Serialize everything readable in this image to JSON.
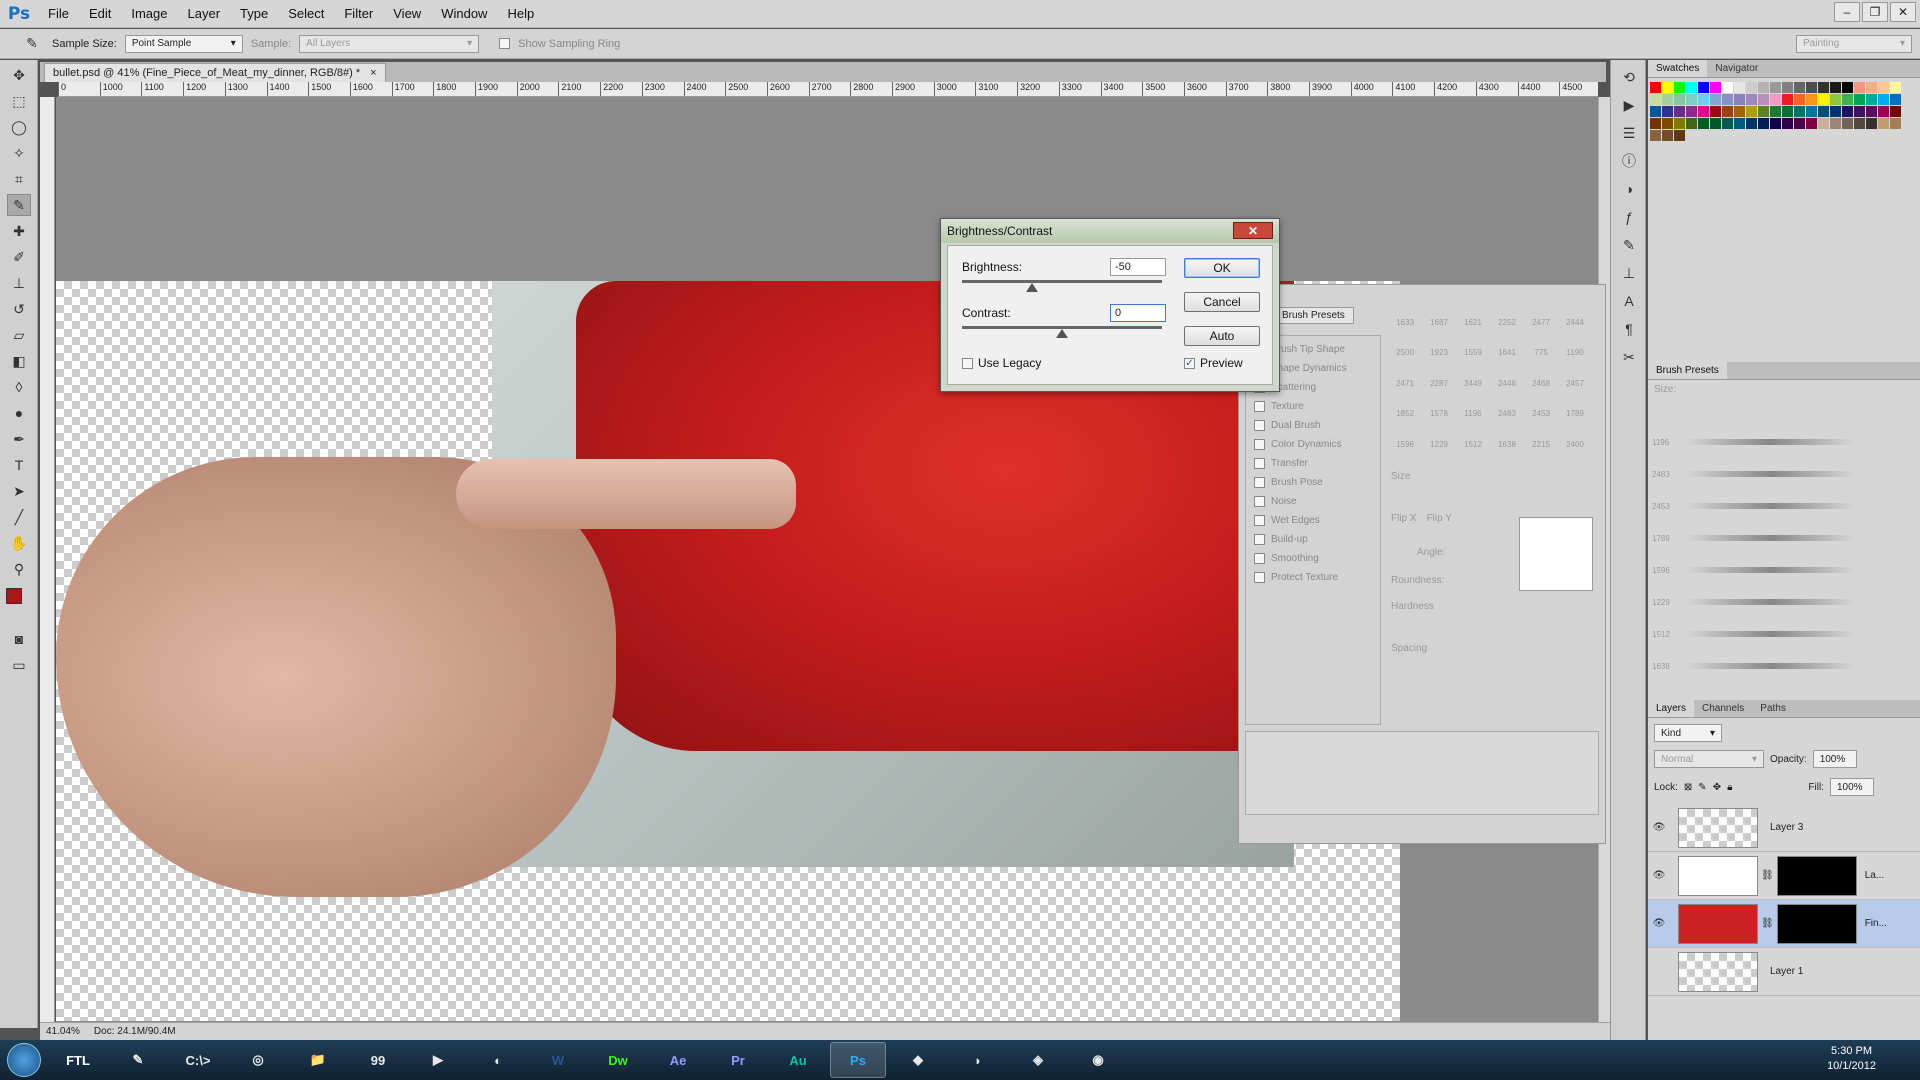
{
  "app": {
    "logo": "Ps"
  },
  "menu": [
    "File",
    "Edit",
    "Image",
    "Layer",
    "Type",
    "Select",
    "Filter",
    "View",
    "Window",
    "Help"
  ],
  "window_controls": {
    "minimize": "–",
    "restore": "❐",
    "close": "✕"
  },
  "options": {
    "sample_size_label": "Sample Size:",
    "sample_size_value": "Point Sample",
    "sample_label": "Sample:",
    "sample_value": "All Layers",
    "sampling_ring_label": "Show Sampling Ring",
    "workspace": "Painting"
  },
  "document": {
    "tab_title": "bullet.psd @ 41% (Fine_Piece_of_Meat_my_dinner, RGB/8#) *",
    "tab_close": "×"
  },
  "ruler_h_ticks": [
    "0",
    "1000",
    "1100",
    "1200",
    "1300",
    "1400",
    "1500",
    "1600",
    "1700",
    "1800",
    "1900",
    "2000",
    "2100",
    "2200",
    "2300",
    "2400",
    "2500",
    "2600",
    "2700",
    "2800",
    "2900",
    "3000",
    "3100",
    "3200",
    "3300",
    "3400",
    "3500",
    "3600",
    "3700",
    "3800",
    "3900",
    "4000",
    "4100",
    "4200",
    "4300",
    "4400",
    "4500"
  ],
  "status": {
    "zoom": "41.04%",
    "doc": "Doc: 24.1M/90.4M"
  },
  "dialog": {
    "title": "Brightness/Contrast",
    "close": "✕",
    "brightness_label": "Brightness:",
    "brightness_value": "-50",
    "contrast_label": "Contrast:",
    "contrast_value": "0",
    "use_legacy_label": "Use Legacy",
    "preview_label": "Preview",
    "preview_checked": true,
    "use_legacy_checked": false,
    "ok": "OK",
    "cancel": "Cancel",
    "auto": "Auto",
    "brightness_fraction": 0.35,
    "contrast_fraction": 0.5
  },
  "brush_panel": {
    "tab": "Brush Presets",
    "items": [
      "Brush Tip Shape",
      "Shape Dynamics",
      "Scattering",
      "Texture",
      "Dual Brush",
      "Color Dynamics",
      "Transfer",
      "Brush Pose",
      "Noise",
      "Wet Edges",
      "Build-up",
      "Smoothing",
      "Protect Texture"
    ],
    "sizes": [
      "1633",
      "1687",
      "1621",
      "2252",
      "2477",
      "2444",
      "2500",
      "1923",
      "1559",
      "1641",
      "775",
      "1190",
      "2471",
      "2287",
      "2449",
      "2446",
      "2468",
      "2457",
      "1852",
      "1578",
      "1196",
      "2483",
      "2453",
      "1789",
      "1596",
      "1229",
      "1512",
      "1638",
      "2215",
      "2400"
    ],
    "size_label": "Size",
    "flip_x": "Flip X",
    "flip_y": "Flip Y",
    "angle": "Angle:",
    "roundness": "Roundness:",
    "hardness": "Hardness",
    "spacing": "Spacing"
  },
  "swatches_tabs": [
    "Swatches",
    "Navigator"
  ],
  "swatch_colors": [
    "#ff0000",
    "#ffff00",
    "#00ff00",
    "#00ffff",
    "#0000ff",
    "#ff00ff",
    "#ffffff",
    "#e6e6e6",
    "#cccccc",
    "#b3b3b3",
    "#999999",
    "#808080",
    "#666666",
    "#4d4d4d",
    "#333333",
    "#1a1a1a",
    "#000000",
    "#f7977a",
    "#f9ad81",
    "#fdc68a",
    "#fff79a",
    "#c4df9b",
    "#a2d39c",
    "#82ca9d",
    "#7bcdc8",
    "#6ecff6",
    "#7ea7d8",
    "#8493ca",
    "#8882be",
    "#a187be",
    "#bc8dbf",
    "#f49ac2",
    "#ed1c24",
    "#f26522",
    "#f7941d",
    "#fff200",
    "#8dc63f",
    "#39b54a",
    "#00a651",
    "#00a99d",
    "#00aeef",
    "#0072bc",
    "#0054a6",
    "#2e3192",
    "#662d91",
    "#92278f",
    "#ec008c",
    "#9e0b0f",
    "#a0410d",
    "#a36209",
    "#aba000",
    "#598527",
    "#1a7b30",
    "#007236",
    "#00746b",
    "#0076a3",
    "#004b80",
    "#003471",
    "#1b1464",
    "#440e62",
    "#630460",
    "#9e005d",
    "#790000",
    "#7b2e00",
    "#7d4900",
    "#827b00",
    "#406618",
    "#005e20",
    "#005826",
    "#005952",
    "#005b7f",
    "#003663",
    "#002157",
    "#0d004c",
    "#32004b",
    "#4b0049",
    "#7b0046",
    "#c7b299",
    "#998675",
    "#736357",
    "#534741",
    "#37302d",
    "#c69c6d",
    "#a67c52",
    "#8c6239",
    "#754c24",
    "#603913"
  ],
  "brush_presets_panel": {
    "title": "Brush Presets",
    "size_label": "Size:",
    "brush_sizes": [
      "1196",
      "2483",
      "2453",
      "1789",
      "1596",
      "1229",
      "1512",
      "1638"
    ]
  },
  "layers_tabs": [
    "Layers",
    "Channels",
    "Paths"
  ],
  "layers": {
    "kind": "Kind",
    "blend": "Normal",
    "opacity_label": "Opacity:",
    "opacity": "100%",
    "lock_label": "Lock:",
    "fill_label": "Fill:",
    "fill": "100%",
    "rows": [
      {
        "name": "Layer 3"
      },
      {
        "name": "La..."
      },
      {
        "name": "Fin..."
      },
      {
        "name": "Layer 1"
      }
    ]
  },
  "taskbar": {
    "apps": [
      "FTL",
      "✎",
      "C:\\>",
      "◎",
      "📁",
      "99",
      "▶",
      "◐",
      "W",
      "Dw",
      "Ae",
      "Pr",
      "Au",
      "Ps",
      "◆",
      "◗",
      "◈",
      "◉"
    ],
    "time": "5:30 PM",
    "date": "10/1/2012"
  }
}
